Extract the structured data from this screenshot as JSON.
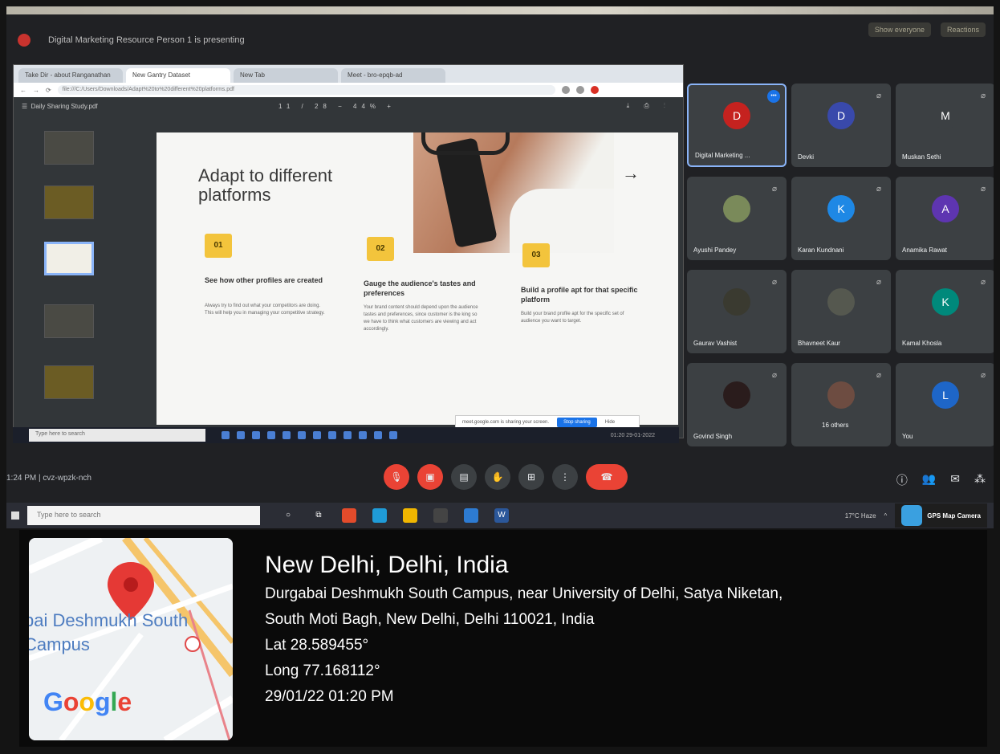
{
  "presenting_text": "Digital Marketing Resource Person 1 is presenting",
  "top_right": [
    "Show everyone",
    "Reactions"
  ],
  "browser": {
    "tabs": [
      "Take Dir - about Ranganathan",
      "New Gantry Dataset",
      "New Tab",
      "Meet - bro-epqb-ad"
    ],
    "url": "file:///C:/Users/Downloads/Adapt%20to%20different%20platforms.pdf",
    "pdf_name": "Daily Sharing Study.pdf",
    "page_info": "11 / 28",
    "zoom": "44%"
  },
  "slide": {
    "title": "Adapt to different platforms",
    "arrow": "→",
    "columns": [
      {
        "num": "01",
        "heading": "See how other profiles are created",
        "body": "Always try to find out what your competitors are doing. This will help you in managing your competitive strategy."
      },
      {
        "num": "02",
        "heading": "Gauge the audience's tastes and preferences",
        "body": "Your brand content should depend upon the audience tastes and preferences, since customer is the king so we have to think what customers are viewing and act accordingly."
      },
      {
        "num": "03",
        "heading": "Build a profile apt for that specific platform",
        "body": "Build your brand profile apt for the specific set of audience you want to target."
      }
    ]
  },
  "share_banner": {
    "text": "meet.google.com is sharing your screen.",
    "stop": "Stop sharing",
    "hide": "Hide"
  },
  "inner_taskbar": {
    "search": "Type here to search",
    "clock": "01:20 29-01-2022"
  },
  "participants": [
    {
      "initial": "D",
      "name": "Digital Marketing ...",
      "color": "#c5221f"
    },
    {
      "initial": "D",
      "name": "Devki",
      "color": "#3949ab"
    },
    {
      "initial": "M",
      "name": "Muskan Sethi",
      "color": "#3c4043"
    },
    {
      "initial": "",
      "name": "Ayushi Pandey",
      "color": "#7a8a5a"
    },
    {
      "initial": "K",
      "name": "Karan Kundnani",
      "color": "#1e88e5"
    },
    {
      "initial": "A",
      "name": "Anamika Rawat",
      "color": "#5e35b1"
    },
    {
      "initial": "",
      "name": "Gaurav Vashist",
      "color": "#3a3a30"
    },
    {
      "initial": "",
      "name": "Bhavneet Kaur",
      "color": "#55584f"
    },
    {
      "initial": "K",
      "name": "Kamal Khosla",
      "color": "#00897b"
    },
    {
      "initial": "",
      "name": "Govind Singh",
      "color": "#2a1c1c"
    },
    {
      "initial": "",
      "name": "16 others",
      "color": "#6d4c41"
    },
    {
      "initial": "L",
      "name": "You",
      "color": "#1e66c8"
    }
  ],
  "meet": {
    "info": "1:24 PM  |  cvz-wpzk-nch"
  },
  "outer_taskbar": {
    "search": "Type here to search",
    "weather": "17°C Haze",
    "app": "GPS Map Camera"
  },
  "gps": {
    "map_label": "bai Deshmukh South Campus",
    "brand": "Google",
    "title": "New Delhi, Delhi, India",
    "address_line1": "Durgabai Deshmukh South Campus, near University of Delhi, Satya Niketan,",
    "address_line2": "South Moti Bagh, New Delhi, Delhi 110021, India",
    "lat": "Lat 28.589455°",
    "long": "Long 77.168112°",
    "datetime": "29/01/22 01:20 PM"
  }
}
